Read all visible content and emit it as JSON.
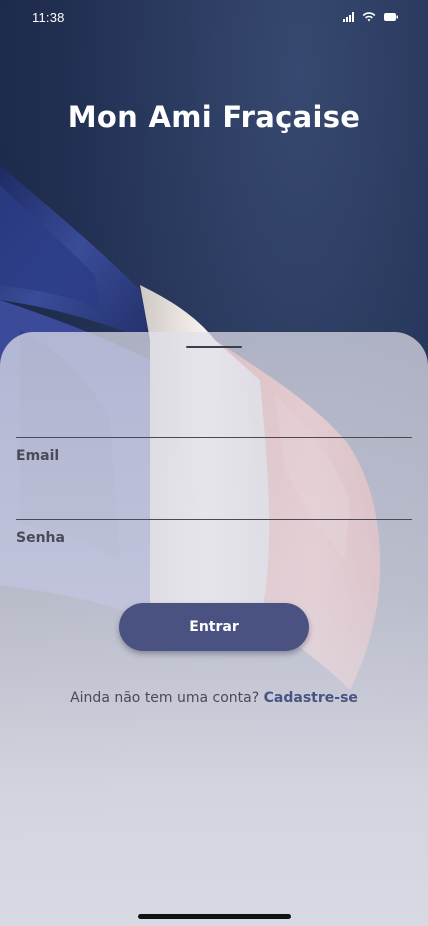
{
  "status_bar": {
    "time": "11:38",
    "icons": [
      "signal-icon",
      "wifi-icon",
      "battery-icon"
    ]
  },
  "app": {
    "title": "Mon Ami Fraçaise"
  },
  "form": {
    "email_label": "Email",
    "email_value": "",
    "password_label": "Senha",
    "password_value": "",
    "login_label": "Entrar"
  },
  "signup": {
    "prompt": "Ainda não tem uma conta?",
    "link_label": "Cadastre-se"
  },
  "colors": {
    "background": "#1f2c4d",
    "accent": "#4a5282",
    "sheet": "#dcdce6",
    "flag_blue": "#2b3a78",
    "flag_white": "#f2ece6",
    "flag_red": "#e0796e"
  }
}
